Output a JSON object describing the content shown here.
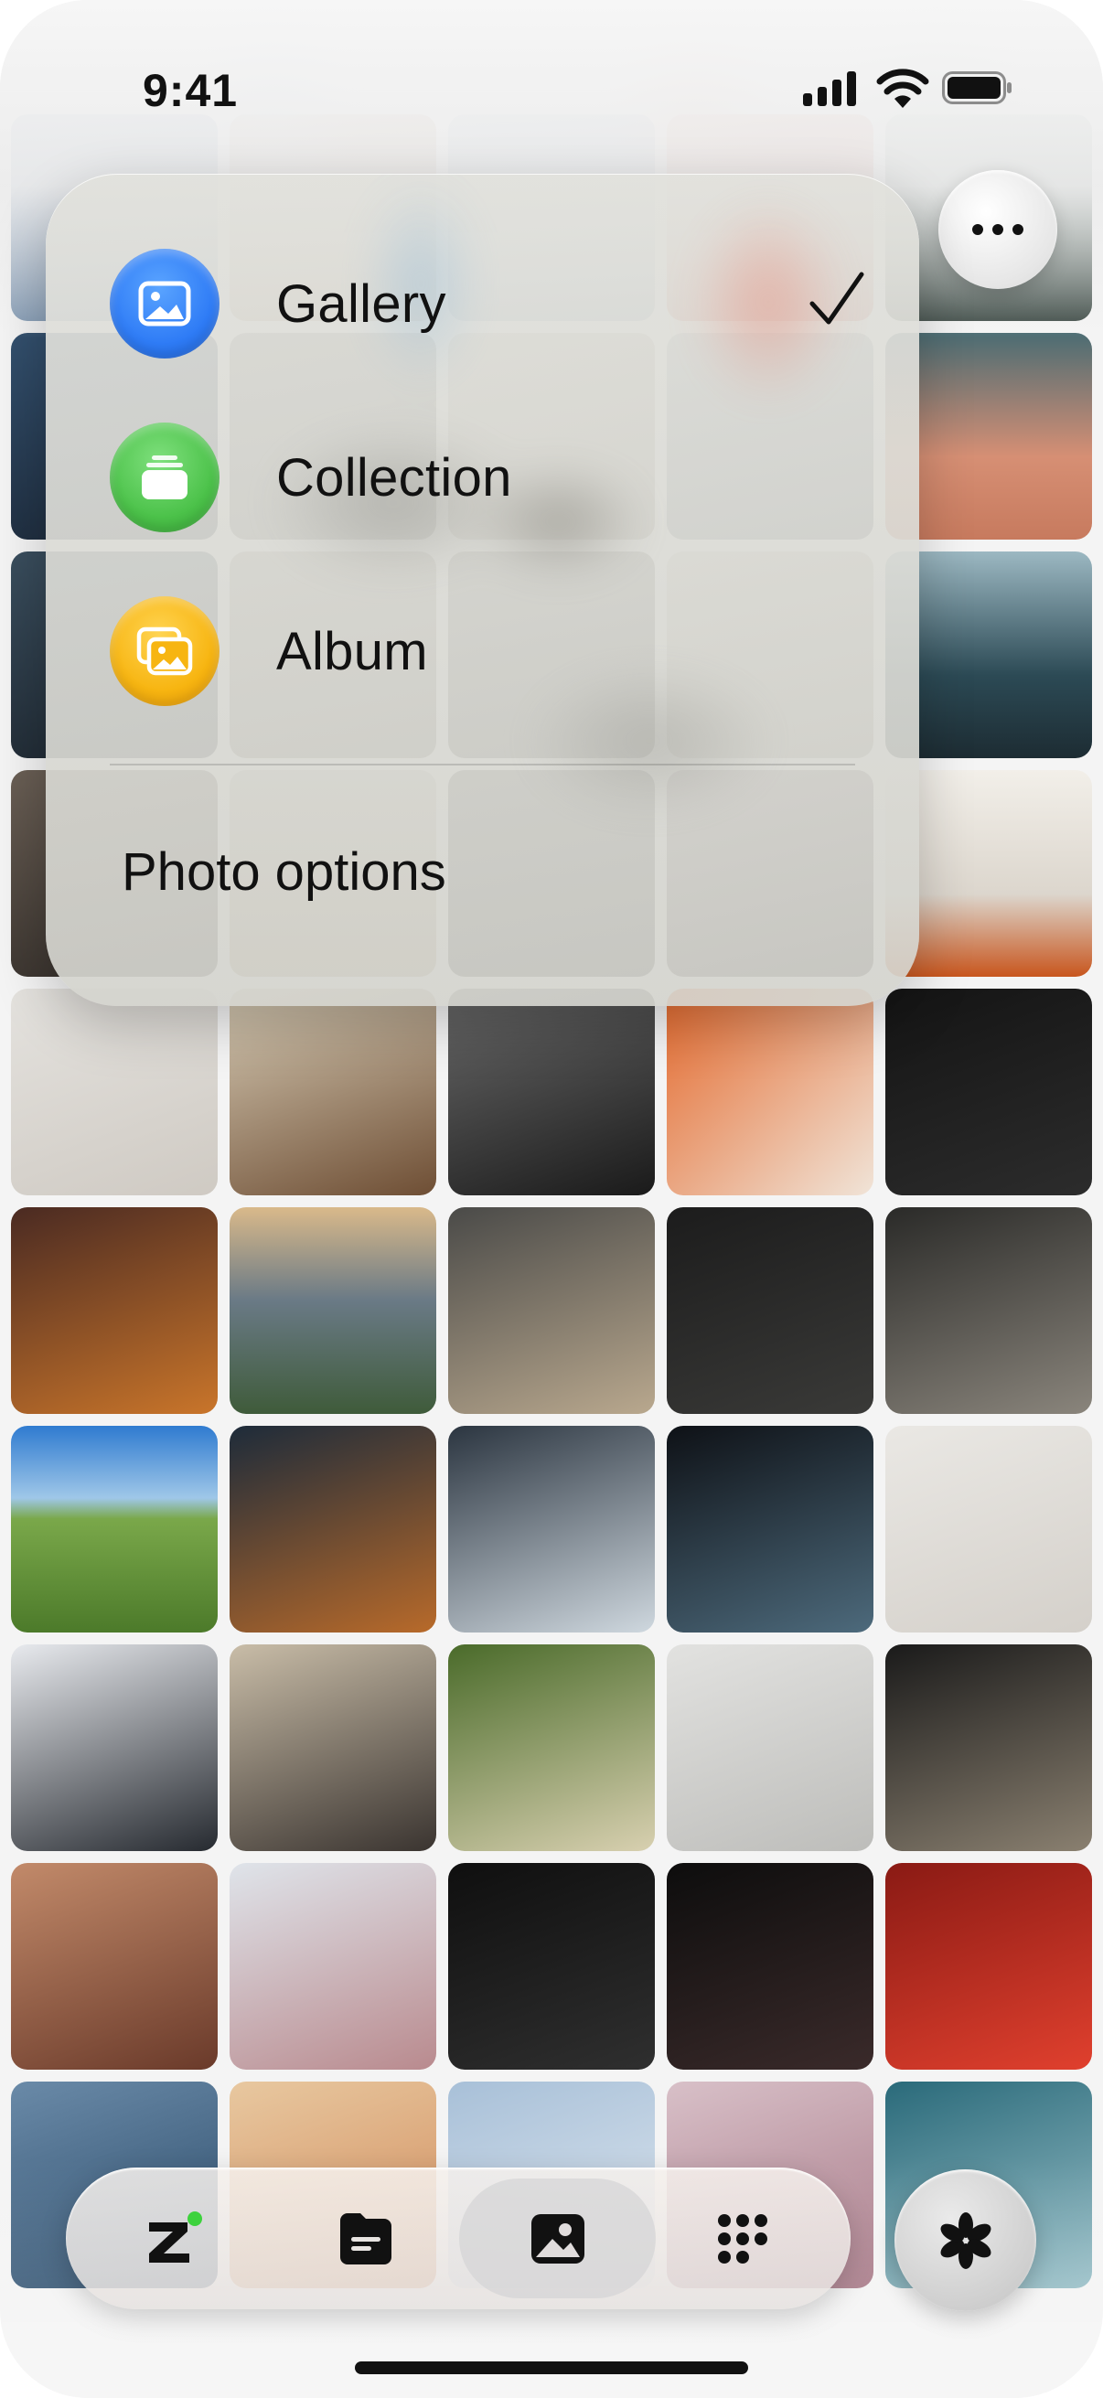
{
  "status_bar": {
    "time": "9:41",
    "icons": [
      "cellular-signal-icon",
      "wifi-icon",
      "battery-icon"
    ]
  },
  "header": {
    "more_button_icon": "ellipsis-icon"
  },
  "menu": {
    "items": [
      {
        "label": "Gallery",
        "icon": "gallery-icon",
        "icon_color": "#2f7cf6",
        "selected": true
      },
      {
        "label": "Collection",
        "icon": "collection-icon",
        "icon_color": "#4cc24a",
        "selected": false
      },
      {
        "label": "Album",
        "icon": "album-icon",
        "icon_color": "#f7b511",
        "selected": false
      }
    ],
    "footer_option": "Photo options",
    "selected_indicator_icon": "checkmark-icon"
  },
  "grid": {
    "columns": 5,
    "photos": [
      "tile-1",
      "tile-2",
      "tile-3",
      "tile-4",
      "tile-5",
      "tile-6",
      "tile-7",
      "tile-8",
      "tile-9",
      "tile-10",
      "tile-11",
      "tile-12",
      "tile-13",
      "tile-14",
      "tile-15",
      "tile-16",
      "tile-17",
      "tile-18",
      "tile-19",
      "tile-20",
      "tile-21",
      "tile-22",
      "tile-23",
      "tile-24",
      "tile-25",
      "tile-26",
      "tile-27",
      "tile-28",
      "tile-29",
      "tile-30",
      "tile-31",
      "tile-32",
      "tile-33",
      "tile-34",
      "tile-35",
      "tile-36",
      "tile-37",
      "tile-38",
      "tile-39",
      "tile-40",
      "tile-41",
      "tile-42",
      "tile-43",
      "tile-44",
      "tile-45",
      "tile-46",
      "tile-47",
      "tile-48",
      "tile-49",
      "tile-50"
    ]
  },
  "tab_bar": {
    "tabs": [
      {
        "id": "z",
        "icon": "z-logo-icon",
        "has_badge": true
      },
      {
        "id": "files",
        "icon": "document-icon"
      },
      {
        "id": "photos",
        "icon": "photo-icon",
        "selected": true
      },
      {
        "id": "apps",
        "icon": "grid-dots-icon"
      }
    ],
    "side_button_icon": "flower-icon"
  },
  "colors": {
    "accent_blue": "#2f7cf6",
    "accent_green": "#4cc24a",
    "accent_yellow": "#f7b511",
    "badge_green": "#3dd23d"
  }
}
